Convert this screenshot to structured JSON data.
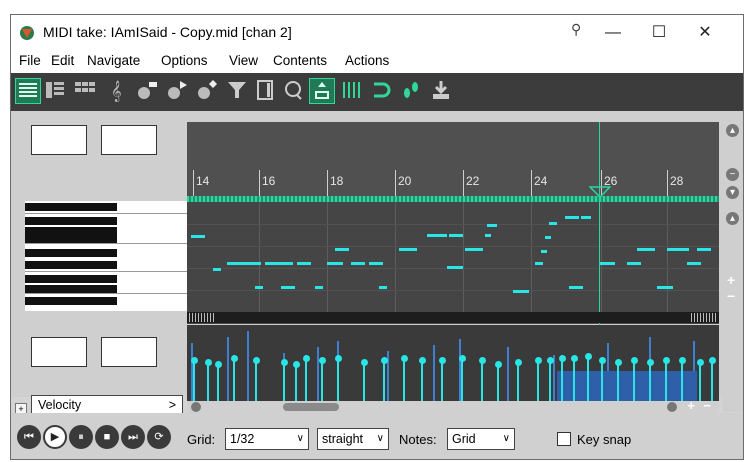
{
  "window": {
    "title": "MIDI take: IAmISaid - Copy.mid [chan 2]",
    "pin_glyph": "⚲",
    "minimize_glyph": "—",
    "maximize_glyph": "☐",
    "close_glyph": "✕"
  },
  "menu": [
    "File",
    "Edit",
    "Navigate",
    "Options",
    "View",
    "Contents",
    "Actions"
  ],
  "toolbar": {
    "icons": [
      "piano-roll-view-icon",
      "named-notes-view-icon",
      "drum-grid-view-icon",
      "notation-view-icon",
      "insert-note-icon",
      "play-note-icon",
      "step-input-icon",
      "filter-icon",
      "list-view-icon",
      "lasso-icon",
      "chase-icon",
      "snap-grid-icon",
      "loop-icon",
      "footstep-icon",
      "save-icon"
    ]
  },
  "ruler": {
    "labels": [
      "14",
      "16",
      "18",
      "20",
      "22",
      "24",
      "26",
      "28"
    ]
  },
  "lane": {
    "selector": "Velocity",
    "selector_arrow": ">",
    "expand": "+"
  },
  "transport": {
    "buttons": [
      "rewind",
      "play",
      "pause",
      "stop",
      "forward",
      "repeat"
    ]
  },
  "bottom": {
    "grid_label": "Grid:",
    "grid_value": "1/32",
    "swing_value": "straight",
    "notes_label": "Notes:",
    "notes_value": "Grid",
    "keysnap_label": "Key snap",
    "keysnap_checked": false
  },
  "colors": {
    "note": "#29e6e6",
    "cursor": "#29d7a0",
    "toolbar_active": "#1f7a55",
    "velocity_bar": "#3f7fd2"
  }
}
